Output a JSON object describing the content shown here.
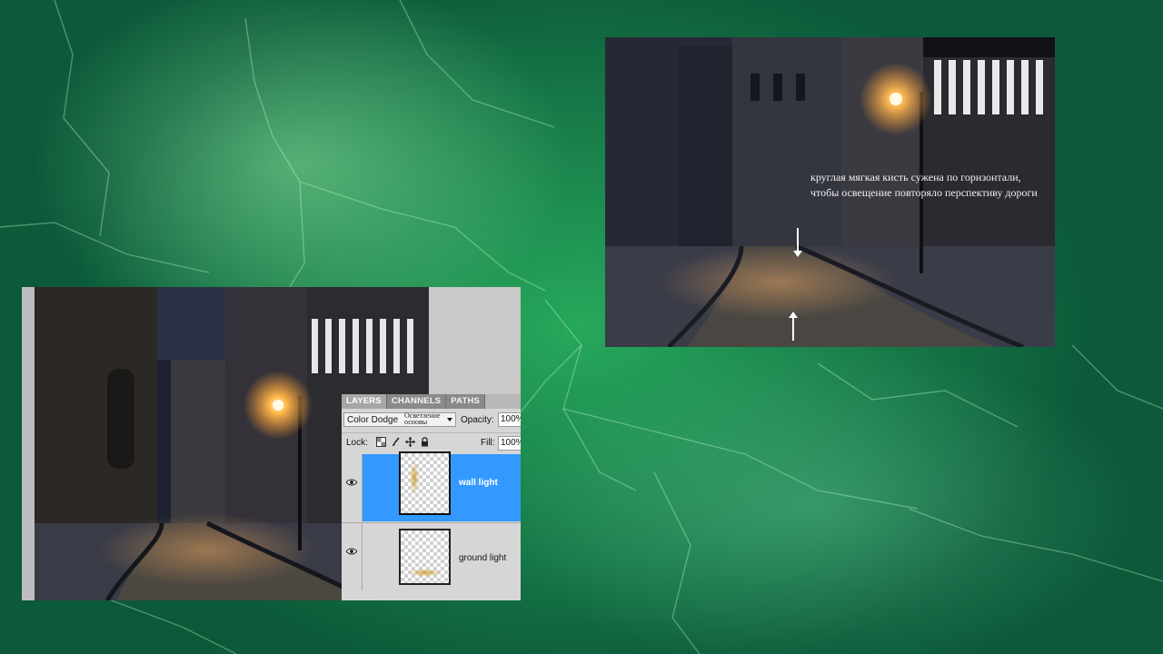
{
  "annotation": {
    "text": "круглая мягкая кисть сужена по горизонтали, чтобы освещение повторяло перспективу дороги"
  },
  "layers_panel": {
    "tabs": [
      {
        "label": "LAYERS",
        "active": true
      },
      {
        "label": "CHANNELS",
        "active": false
      },
      {
        "label": "PATHS",
        "active": false
      }
    ],
    "blend_mode": "Color Dodge",
    "blend_mode_translation": "Осветление основы",
    "opacity_label": "Opacity:",
    "opacity_value": "100%",
    "lock_label": "Lock:",
    "fill_label": "Fill:",
    "fill_value": "100%",
    "layers": [
      {
        "name": "wall light",
        "selected": true,
        "visible": true
      },
      {
        "name": "ground light",
        "selected": false,
        "visible": true
      }
    ]
  },
  "colors": {
    "selected_layer": "#3399ff",
    "background_green": "#1e8f52",
    "lamp_glow": "#ffb347"
  }
}
